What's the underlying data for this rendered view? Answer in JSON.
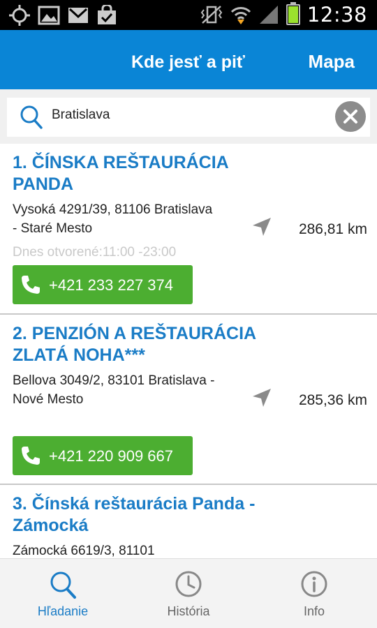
{
  "status_bar": {
    "time": "12:38",
    "icons": [
      "gps-icon",
      "image-icon",
      "gmail-icon",
      "shopping-bag-icon",
      "vibrate-icon",
      "wifi-icon",
      "signal-icon",
      "battery-icon"
    ]
  },
  "app_bar": {
    "title": "Kde jesť a piť",
    "map_label": "Mapa"
  },
  "search": {
    "value": "Bratislava",
    "placeholder": ""
  },
  "results": [
    {
      "title_line1": "1. ČÍNSKA REŠTAURÁCIA",
      "title_line2": "PANDA",
      "address_line1": "Vysoká 4291/39, 81106 Bratislava",
      "address_line2": "- Staré Mesto",
      "hours": "Dnes otvorené:11:00 -23:00",
      "distance": "286,81 km",
      "phone": "+421 233 227 374"
    },
    {
      "title_line1": "2. PENZIÓN A REŠTAURÁCIA",
      "title_line2": "ZLATÁ NOHA***",
      "address_line1": "Bellova 3049/2, 83101 Bratislava -",
      "address_line2": "Nové Mesto",
      "hours": "",
      "distance": "285,36 km",
      "phone": "+421 220 909 667"
    },
    {
      "title_line1": "3. Čínská reštaurácia Panda -",
      "title_line2": "Zámocká",
      "address_line1": "Zámocká 6619/3, 81101",
      "address_line2": "",
      "hours": "",
      "distance": "",
      "phone": ""
    }
  ],
  "bottom_nav": {
    "tabs": [
      {
        "label": "Hľadanie",
        "icon": "search-icon",
        "active": true
      },
      {
        "label": "História",
        "icon": "clock-icon",
        "active": false
      },
      {
        "label": "Info",
        "icon": "info-icon",
        "active": false
      }
    ]
  },
  "colors": {
    "app_bar": "#0a85d6",
    "title_link": "#1a7cc6",
    "call_button": "#4cae31",
    "hours_text": "#c9c9c9"
  }
}
